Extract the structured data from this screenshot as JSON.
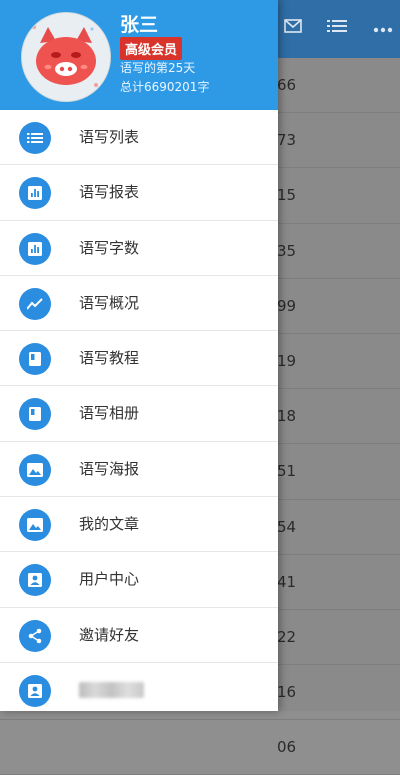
{
  "background": {
    "row_numbers": [
      "66",
      "73",
      "15",
      "35",
      "99",
      "19",
      "18",
      "51",
      "54",
      "41",
      "22",
      "16",
      "06"
    ]
  },
  "profile": {
    "name": "张三",
    "badge": "高级会员",
    "days": "语写的第25天",
    "total": "总计6690201字"
  },
  "menu": [
    {
      "label": "语写列表",
      "icon": "list-icon"
    },
    {
      "label": "语写报表",
      "icon": "bar-chart-icon"
    },
    {
      "label": "语写字数",
      "icon": "bar-chart-icon"
    },
    {
      "label": "语写概况",
      "icon": "trend-icon"
    },
    {
      "label": "语写教程",
      "icon": "book-icon"
    },
    {
      "label": "语写相册",
      "icon": "book-icon"
    },
    {
      "label": "语写海报",
      "icon": "image-icon"
    },
    {
      "label": "我的文章",
      "icon": "image-icon"
    },
    {
      "label": "用户中心",
      "icon": "person-icon"
    },
    {
      "label": "邀请好友",
      "icon": "share-icon"
    }
  ],
  "colors": {
    "header_blue": "#2e9ae6",
    "icon_blue": "#2a8de0",
    "badge_red": "#d9342b"
  }
}
